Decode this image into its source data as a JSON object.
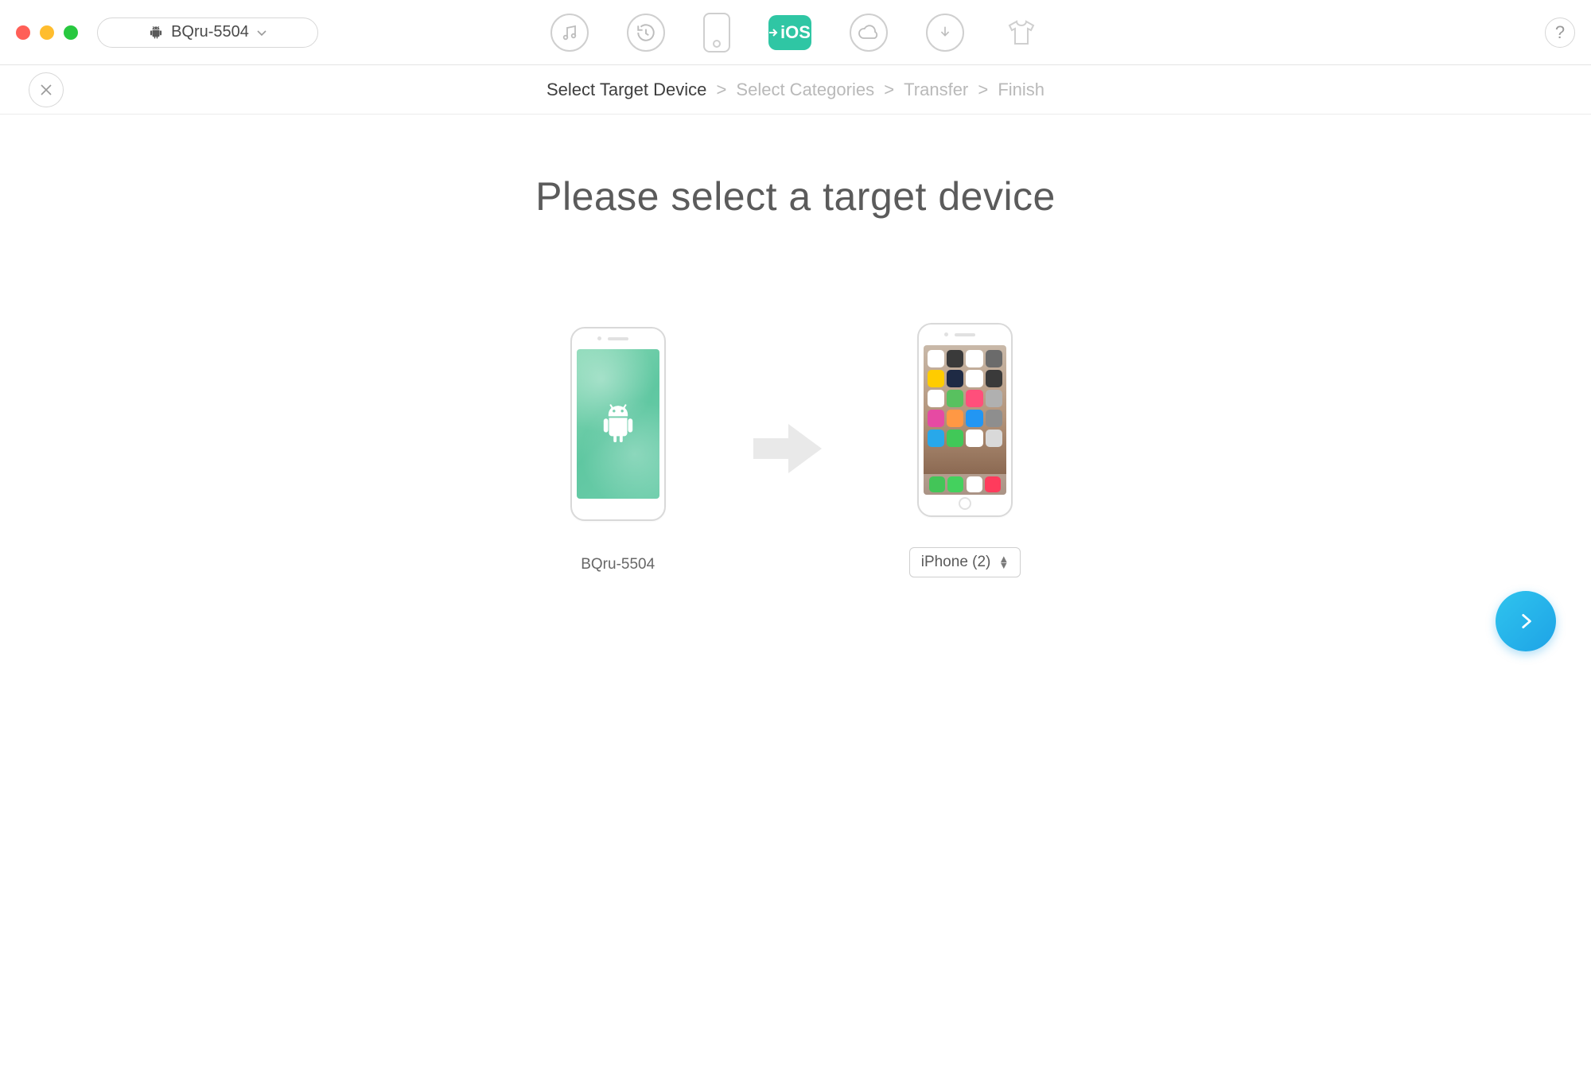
{
  "toolbar": {
    "device_dropdown": "BQru-5504",
    "ios_badge": "iOS",
    "help_label": "?"
  },
  "breadcrumb": {
    "step1": "Select Target Device",
    "step2": "Select Categories",
    "step3": "Transfer",
    "step4": "Finish"
  },
  "headline": "Please select a target device",
  "source_device": {
    "name": "BQru-5504"
  },
  "target_device": {
    "selected": "iPhone (2)"
  },
  "colors": {
    "accent_teal": "#2fc6a4",
    "accent_blue_a": "#2fc4ee",
    "accent_blue_b": "#1ea3e6"
  },
  "ios_app_colors": [
    "#ffffff",
    "#3a3a3a",
    "#ffffff",
    "#6b6b6b",
    "#ffcc00",
    "#1e2a44",
    "#ffffff",
    "#3a3a3a",
    "#ffffff",
    "#58c15f",
    "#ff4f7b",
    "#b0b0b0",
    "#e64aa3",
    "#ff9844",
    "#2296f3",
    "#8e8e8e",
    "#28a8ea",
    "#41c858",
    "#ffffff",
    "#d9d9d9"
  ],
  "ios_dock_colors": [
    "#43c558",
    "#44d15e",
    "#ffffff",
    "#ff3b5c"
  ]
}
